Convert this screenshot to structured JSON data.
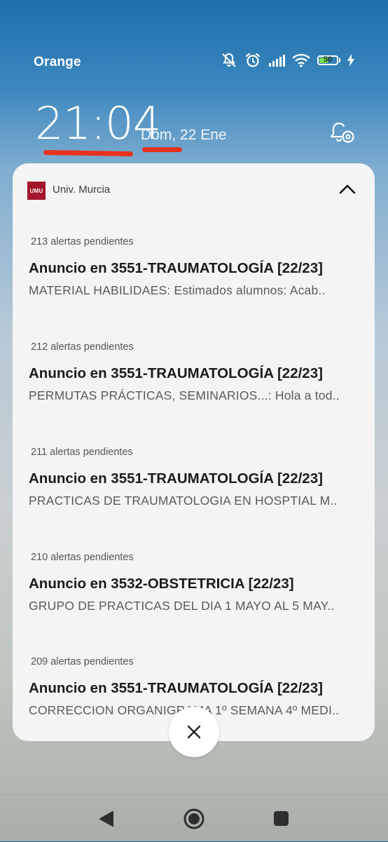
{
  "status_bar": {
    "carrier": "Orange",
    "battery_level": "50",
    "icons": [
      "mute-icon",
      "alarm-icon",
      "signal-icon",
      "wifi-icon",
      "battery-icon",
      "charging-icon"
    ]
  },
  "lockscreen": {
    "time": "21:04",
    "date": "Dom, 22 Ene"
  },
  "notification_group": {
    "app_name": "Univ. Murcia",
    "app_logo_text": "UMU",
    "brand_color": "#a3142d",
    "items": [
      {
        "pending": "213 alertas pendientes",
        "title": "Anuncio en 3551-TRAUMATOLOGÍA  [22/23]",
        "body": "MATERIAL HABILIDAES: Estimados alumnos:  Acab.."
      },
      {
        "pending": "212 alertas pendientes",
        "title": "Anuncio en 3551-TRAUMATOLOGÍA  [22/23]",
        "body": "PERMUTAS PRÁCTICAS, SEMINARIOS...: Hola a tod.."
      },
      {
        "pending": "211 alertas pendientes",
        "title": "Anuncio en 3551-TRAUMATOLOGÍA  [22/23]",
        "body": "PRACTICAS DE TRAUMATOLOGIA  EN HOSPTIAL M.."
      },
      {
        "pending": "210 alertas pendientes",
        "title": "Anuncio en 3532-OBSTETRICIA  [22/23]",
        "body": "GRUPO DE PRACTICAS DEL DIA 1 MAYO AL 5 MAY.."
      },
      {
        "pending": "209 alertas pendientes",
        "title": "Anuncio en 3551-TRAUMATOLOGÍA  [22/23]",
        "body": "CORRECCION ORGANIGRAMA 1º SEMANA 4º MEDI.."
      }
    ]
  },
  "annotation_color": "#e8321e"
}
